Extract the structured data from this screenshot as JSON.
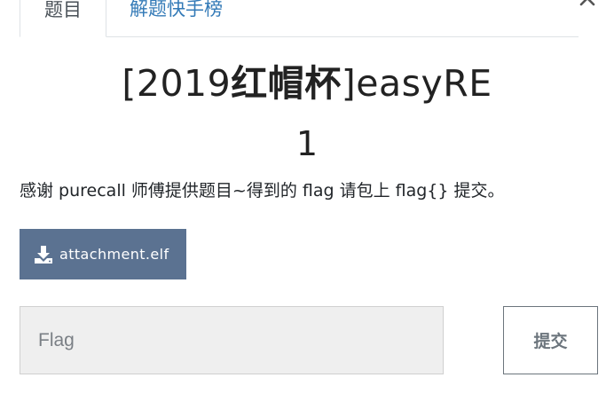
{
  "tabs": {
    "challenge": "题目",
    "solves": "解题快手榜"
  },
  "challenge": {
    "title_prefix": "[2019",
    "title_cn": "红帽杯",
    "title_suffix": "]easyRE",
    "points": "1",
    "description": "感谢 purecall 师傅提供题目~得到的 flag 请包上 flag{} 提交。"
  },
  "attachment": {
    "filename": "attachment.elf",
    "icon": "download-icon"
  },
  "form": {
    "flag_placeholder": "Flag",
    "submit_label": "提交"
  },
  "colors": {
    "accent": "#337ab7",
    "attachment_bg": "#5b7291",
    "input_bg": "#efefef"
  }
}
